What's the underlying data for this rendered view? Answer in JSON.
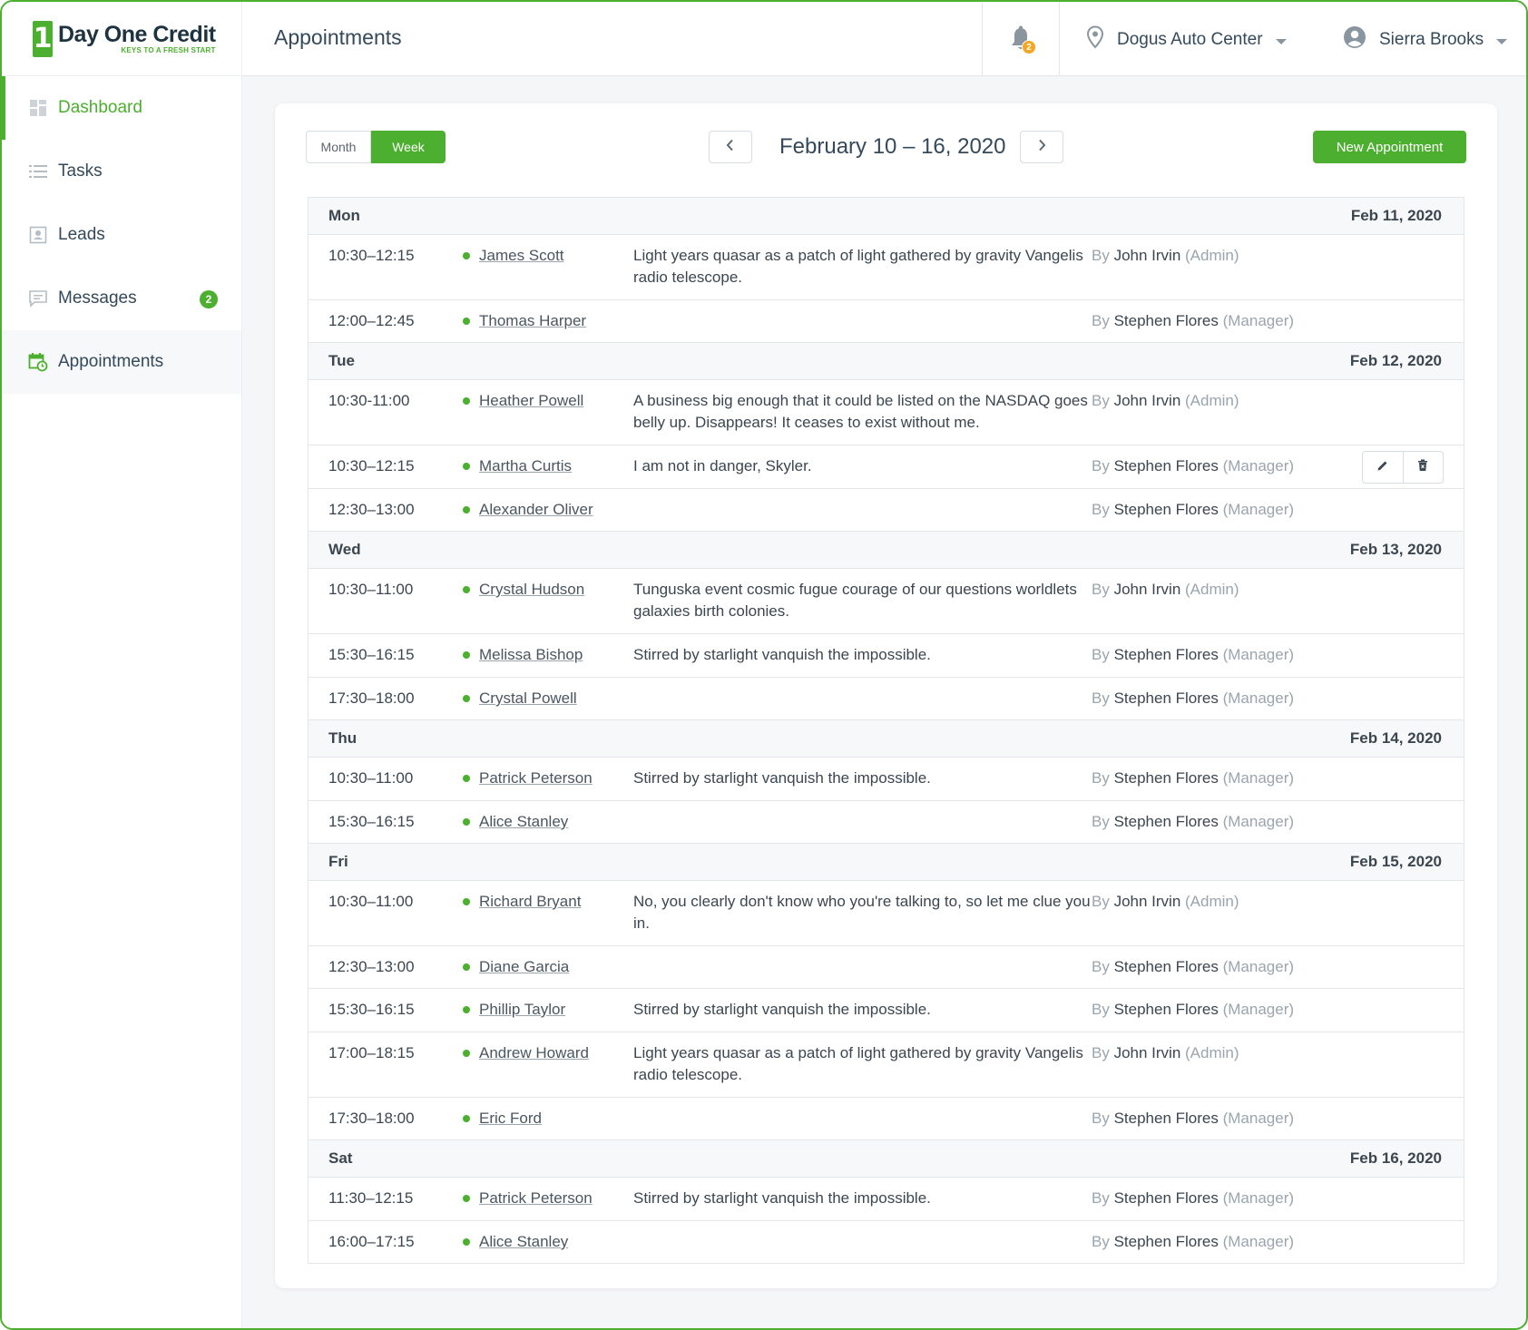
{
  "brand": {
    "name": "Day One Credit",
    "tagline": "KEYS TO A FRESH START",
    "mark": "1",
    "color": "#4caf2f"
  },
  "sidebar": {
    "items": [
      {
        "label": "Dashboard",
        "icon": "dashboard-icon"
      },
      {
        "label": "Tasks",
        "icon": "list-icon"
      },
      {
        "label": "Leads",
        "icon": "contact-card-icon"
      },
      {
        "label": "Messages",
        "icon": "message-icon",
        "badge": "2"
      },
      {
        "label": "Appointments",
        "icon": "calendar-clock-icon"
      }
    ]
  },
  "header": {
    "title": "Appointments",
    "notifications_count": "2",
    "location": "Dogus Auto Center",
    "user": "Sierra Brooks"
  },
  "toolbar": {
    "month_label": "Month",
    "week_label": "Week",
    "range": "February 10 – 16, 2020",
    "new_label": "New Appointment"
  },
  "schedule": [
    {
      "day": "Mon",
      "date": "Feb 11, 2020",
      "rows": [
        {
          "time": "10:30–12:15",
          "name": "James Scott",
          "note": "Light years quasar as a patch of light gathered by gravity Vangelis radio telescope.",
          "by": "John Irvin",
          "role": "(Admin)"
        },
        {
          "time": "12:00–12:45",
          "name": "Thomas Harper",
          "note": "",
          "by": "Stephen Flores",
          "role": "(Manager)"
        }
      ]
    },
    {
      "day": "Tue",
      "date": "Feb 12, 2020",
      "rows": [
        {
          "time": "10:30-11:00",
          "name": "Heather Powell",
          "note": "A business big enough that it could be listed on the NASDAQ goes belly up. Disappears! It ceases to exist without me.",
          "by": "John Irvin",
          "role": "(Admin)"
        },
        {
          "time": "10:30–12:15",
          "name": "Martha Curtis",
          "note": "I am not in danger, Skyler.",
          "by": "Stephen Flores",
          "role": "(Manager)"
        },
        {
          "time": "12:30–13:00",
          "name": "Alexander Oliver",
          "note": "",
          "by": "Stephen Flores",
          "role": "(Manager)"
        }
      ]
    },
    {
      "day": "Wed",
      "date": "Feb 13, 2020",
      "rows": [
        {
          "time": "10:30–11:00",
          "name": "Crystal Hudson",
          "note": "Tunguska event cosmic fugue courage of our questions worldlets galaxies birth colonies.",
          "by": "John Irvin",
          "role": "(Admin)"
        },
        {
          "time": "15:30–16:15",
          "name": "Melissa Bishop",
          "note": "Stirred by starlight vanquish the impossible.",
          "by": "Stephen Flores",
          "role": "(Manager)"
        },
        {
          "time": "17:30–18:00",
          "name": "Crystal Powell",
          "note": "",
          "by": "Stephen Flores",
          "role": "(Manager)"
        }
      ]
    },
    {
      "day": "Thu",
      "date": "Feb 14, 2020",
      "rows": [
        {
          "time": "10:30–11:00",
          "name": "Patrick Peterson",
          "note": "Stirred by starlight vanquish the impossible.",
          "by": "Stephen Flores",
          "role": "(Manager)"
        },
        {
          "time": "15:30–16:15",
          "name": "Alice Stanley",
          "note": "",
          "by": "Stephen Flores",
          "role": "(Manager)"
        }
      ]
    },
    {
      "day": "Fri",
      "date": "Feb 15, 2020",
      "rows": [
        {
          "time": "10:30–11:00",
          "name": "Richard Bryant",
          "note": "No, you clearly don't know who you're talking to, so let me clue you in.",
          "by": "John Irvin",
          "role": "(Admin)"
        },
        {
          "time": "12:30–13:00",
          "name": "Diane Garcia",
          "note": "",
          "by": "Stephen Flores",
          "role": "(Manager)"
        },
        {
          "time": "15:30–16:15",
          "name": "Phillip Taylor",
          "note": "Stirred by starlight vanquish the impossible.",
          "by": "Stephen Flores",
          "role": "(Manager)"
        },
        {
          "time": "17:00–18:15",
          "name": "Andrew Howard",
          "note": "Light years quasar as a patch of light gathered by gravity Vangelis radio telescope.",
          "by": "John Irvin",
          "role": "(Admin)"
        },
        {
          "time": "17:30–18:00",
          "name": "Eric Ford",
          "note": "",
          "by": "Stephen Flores",
          "role": "(Manager)"
        }
      ]
    },
    {
      "day": "Sat",
      "date": "Feb 16, 2020",
      "rows": [
        {
          "time": "11:30–12:15",
          "name": "Patrick Peterson",
          "note": "Stirred by starlight vanquish the impossible.",
          "by": "Stephen Flores",
          "role": "(Manager)"
        },
        {
          "time": "16:00–17:15",
          "name": "Alice Stanley",
          "note": "",
          "by": "Stephen Flores",
          "role": "(Manager)"
        }
      ]
    }
  ],
  "by_prefix": "By",
  "row_actions": {
    "edit_icon": "pencil-icon",
    "delete_icon": "trash-icon"
  }
}
